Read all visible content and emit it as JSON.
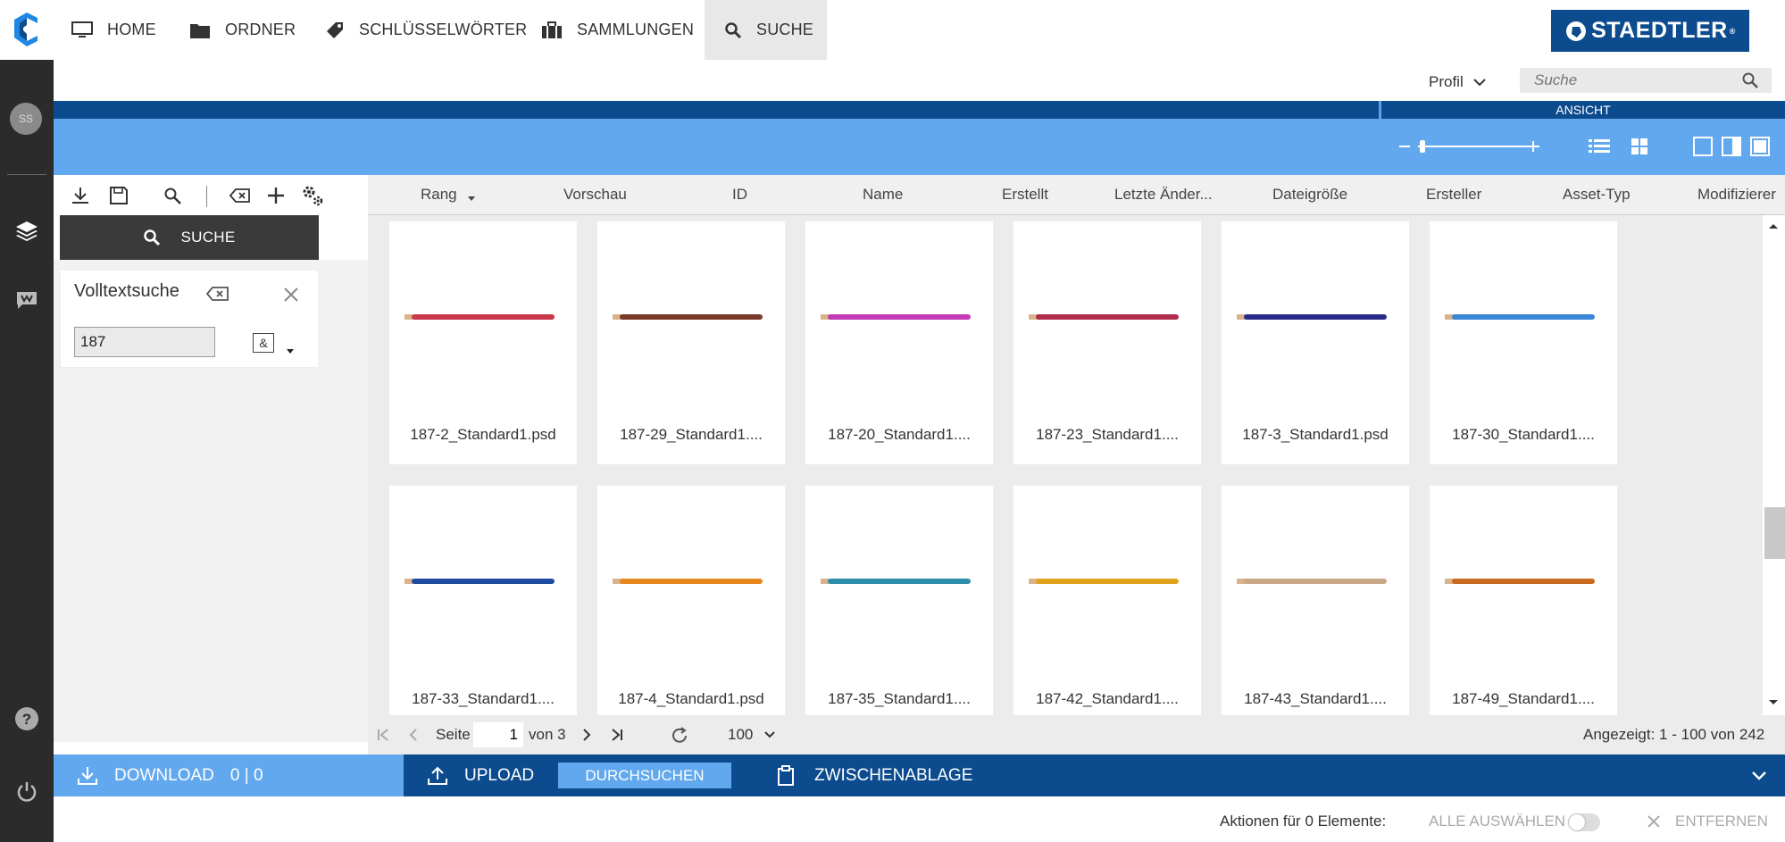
{
  "nav": {
    "home": "HOME",
    "ordner": "ORDNER",
    "schluesselwoerter": "SCHLÜSSELWÖRTER",
    "sammlungen": "SAMMLUNGEN",
    "suche": "SUCHE",
    "brand": "STAEDTLER",
    "brand_reg": "®"
  },
  "user": {
    "initials": "SS"
  },
  "header": {
    "profile_label": "Profil",
    "search_placeholder": "Suche",
    "ansicht_label": "ANSICHT"
  },
  "left_panel": {
    "suche_button": "SUCHE",
    "volltext_title": "Volltextsuche",
    "query_value": "187",
    "operator_label": "&"
  },
  "columns": [
    "Rang",
    "Vorschau",
    "ID",
    "Name",
    "Erstellt",
    "Letzte Änder...",
    "Dateigröße",
    "Ersteller",
    "Asset-Typ",
    "Modifizierer"
  ],
  "assets": [
    {
      "name": "187-2_Standard1.psd",
      "color": "#c8384a"
    },
    {
      "name": "187-29_Standard1....",
      "color": "#7a3a2a"
    },
    {
      "name": "187-20_Standard1....",
      "color": "#c23bb4"
    },
    {
      "name": "187-23_Standard1....",
      "color": "#b02c4c"
    },
    {
      "name": "187-3_Standard1.psd",
      "color": "#2a2a8a"
    },
    {
      "name": "187-30_Standard1....",
      "color": "#3a86d8"
    },
    {
      "name": "187-33_Standard1....",
      "color": "#1e4aa0"
    },
    {
      "name": "187-4_Standard1.psd",
      "color": "#e8861e"
    },
    {
      "name": "187-35_Standard1....",
      "color": "#2c8ea8"
    },
    {
      "name": "187-42_Standard1....",
      "color": "#e0a21c"
    },
    {
      "name": "187-43_Standard1....",
      "color": "#c8a888"
    },
    {
      "name": "187-49_Standard1....",
      "color": "#c86a1e"
    }
  ],
  "pager": {
    "seite_label": "Seite",
    "page_value": "1",
    "of_label": "von 3",
    "page_size": "100",
    "shown": "Angezeigt: 1 - 100 von 242"
  },
  "actions": {
    "download": "DOWNLOAD",
    "download_count": "0 | 0",
    "upload": "UPLOAD",
    "durchsuchen": "DURCHSUCHEN",
    "zwischenablage": "ZWISCHENABLAGE"
  },
  "footer": {
    "aktionen": "Aktionen für 0 Elemente:",
    "alle_auswaehlen": "ALLE AUSWÄHLEN",
    "entfernen": "ENTFERNEN"
  }
}
